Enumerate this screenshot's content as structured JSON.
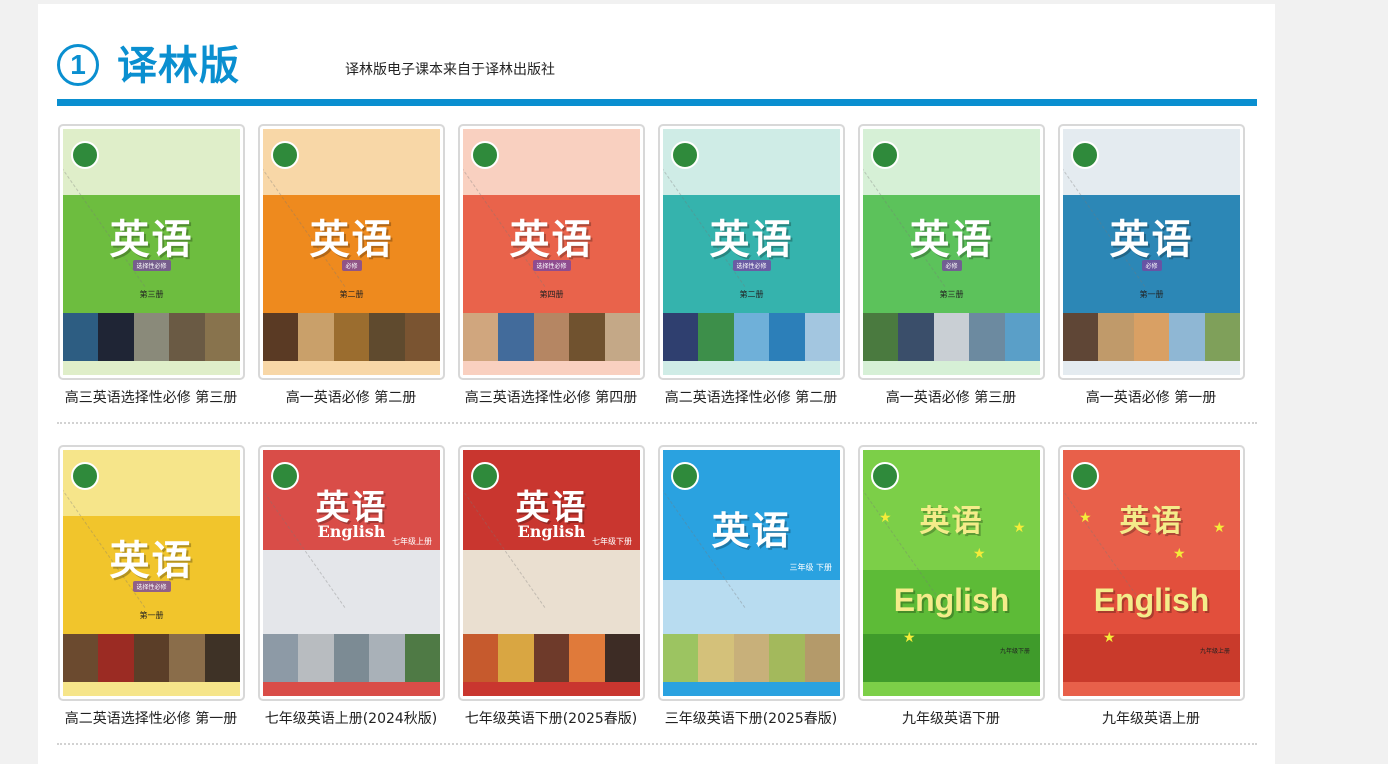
{
  "section": {
    "number": "1",
    "title": "译林版",
    "subtitle": "译林版电子课本来自于译林出版社"
  },
  "rows": [
    {
      "books": [
        {
          "caption": "高三英语选择性必修 第三册",
          "cover_title": "英语",
          "cover_sub": "选择性必修",
          "cover_vol": "第三册",
          "colors": {
            "top": "#dfeec9",
            "mid": "#6dbd3f",
            "photos": [
              "#2d5d82",
              "#1f2535",
              "#8a8a7a",
              "#6a5a44",
              "#88734d"
            ]
          }
        },
        {
          "caption": "高一英语必修 第二册",
          "cover_title": "英语",
          "cover_sub": "必修",
          "cover_vol": "第二册",
          "colors": {
            "top": "#f8d7a7",
            "mid": "#ee8a1e",
            "photos": [
              "#5a3a24",
              "#c9a06a",
              "#9b6d2f",
              "#5f4a2e",
              "#7a5431"
            ]
          }
        },
        {
          "caption": "高三英语选择性必修 第四册",
          "cover_title": "英语",
          "cover_sub": "选择性必修",
          "cover_vol": "第四册",
          "colors": {
            "top": "#f9d0c0",
            "mid": "#e9634b",
            "photos": [
              "#d0a67e",
              "#426b9b",
              "#b58663",
              "#70522f",
              "#c4a887"
            ]
          }
        },
        {
          "caption": "高二英语选择性必修 第二册",
          "cover_title": "英语",
          "cover_sub": "选择性必修",
          "cover_vol": "第二册",
          "colors": {
            "top": "#cfece6",
            "mid": "#35b3ad",
            "photos": [
              "#2f3f6f",
              "#3d8f4a",
              "#6fb0d9",
              "#2c7fb9",
              "#a3c6e0"
            ]
          }
        },
        {
          "caption": "高一英语必修 第三册",
          "cover_title": "英语",
          "cover_sub": "必修",
          "cover_vol": "第三册",
          "colors": {
            "top": "#d6f0d6",
            "mid": "#5cc25b",
            "photos": [
              "#4a7a3f",
              "#3a4e6a",
              "#c9cfd4",
              "#6c8aa0",
              "#5a9fc8"
            ]
          }
        },
        {
          "caption": "高一英语必修 第一册",
          "cover_title": "英语",
          "cover_sub": "必修",
          "cover_vol": "第一册",
          "colors": {
            "top": "#e4ebf0",
            "mid": "#2c87b6",
            "photos": [
              "#5f4636",
              "#c09a6a",
              "#d9a064",
              "#8fb7d4",
              "#7fa05a"
            ]
          }
        }
      ]
    },
    {
      "books": [
        {
          "caption": "高二英语选择性必修 第一册",
          "cover_title": "英语",
          "cover_sub": "选择性必修",
          "cover_vol": "第一册",
          "colors": {
            "top": "#f6e58a",
            "mid": "#f1c52c",
            "photos": [
              "#6b4a2f",
              "#9b2b23",
              "#5b3e28",
              "#8a6d4a",
              "#3e3226"
            ]
          }
        },
        {
          "caption": "七年级英语上册(2024秋版)",
          "cover_title": "英语",
          "cover_en": "English",
          "cover_vol": "七年级上册",
          "style": "junior",
          "colors": {
            "top": "#d94d48",
            "mid": "#e4e6ea",
            "photos": [
              "#8d9aa6",
              "#b8bcc0",
              "#7c8b94",
              "#a9b1b8",
              "#4f7a45"
            ]
          }
        },
        {
          "caption": "七年级英语下册(2025春版)",
          "cover_title": "英语",
          "cover_en": "English",
          "cover_vol": "七年级下册",
          "style": "junior",
          "colors": {
            "top": "#c9362f",
            "mid": "#eadfd0",
            "photos": [
              "#c65a2d",
              "#d9a642",
              "#6e3a2a",
              "#e07a3a",
              "#3d2c25"
            ]
          }
        },
        {
          "caption": "三年级英语下册(2025春版)",
          "cover_title": "英语",
          "cover_vol": "三年级 下册",
          "style": "primary",
          "colors": {
            "top": "#2aa2e0",
            "mid": "#b8dcf0",
            "photos": [
              "#9cc461",
              "#d4c17a",
              "#c8b07a",
              "#a3b95c",
              "#b49a6a"
            ]
          }
        },
        {
          "caption": "九年级英语下册",
          "cover_title": "英语",
          "cover_big_en": "English",
          "cover_vol": "九年级下册",
          "style": "nine",
          "colors": {
            "top": "#7ccf48",
            "mid": "#5dbb37",
            "photos": [
              "#3f9b2b",
              "#3f9b2b",
              "#3f9b2b",
              "#3f9b2b",
              "#3f9b2b"
            ]
          }
        },
        {
          "caption": "九年级英语上册",
          "cover_title": "英语",
          "cover_big_en": "English",
          "cover_vol": "九年级上册",
          "style": "nine",
          "colors": {
            "top": "#e8604a",
            "mid": "#e24f3c",
            "photos": [
              "#c93a2b",
              "#c93a2b",
              "#c93a2b",
              "#c93a2b",
              "#c93a2b"
            ]
          }
        }
      ]
    }
  ]
}
